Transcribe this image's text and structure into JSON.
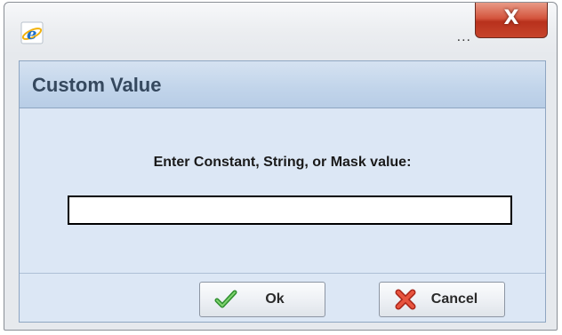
{
  "window": {
    "title": "...",
    "close_label": "X",
    "icon": "internet-explorer-icon"
  },
  "dialog": {
    "title": "Custom Value",
    "prompt": "Enter Constant, String, or Mask value:",
    "input": {
      "value": "",
      "placeholder": ""
    }
  },
  "buttons": {
    "ok": {
      "label": "Ok",
      "icon": "checkmark-icon",
      "icon_color": "#3aa53a"
    },
    "cancel": {
      "label": "Cancel",
      "icon": "x-mark-icon",
      "icon_color": "#d23b2a"
    }
  },
  "colors": {
    "header_bar": "#c1d4ea",
    "header_text": "#35485e",
    "content_bg": "#dce7f5",
    "close_button": "#c7442c"
  }
}
